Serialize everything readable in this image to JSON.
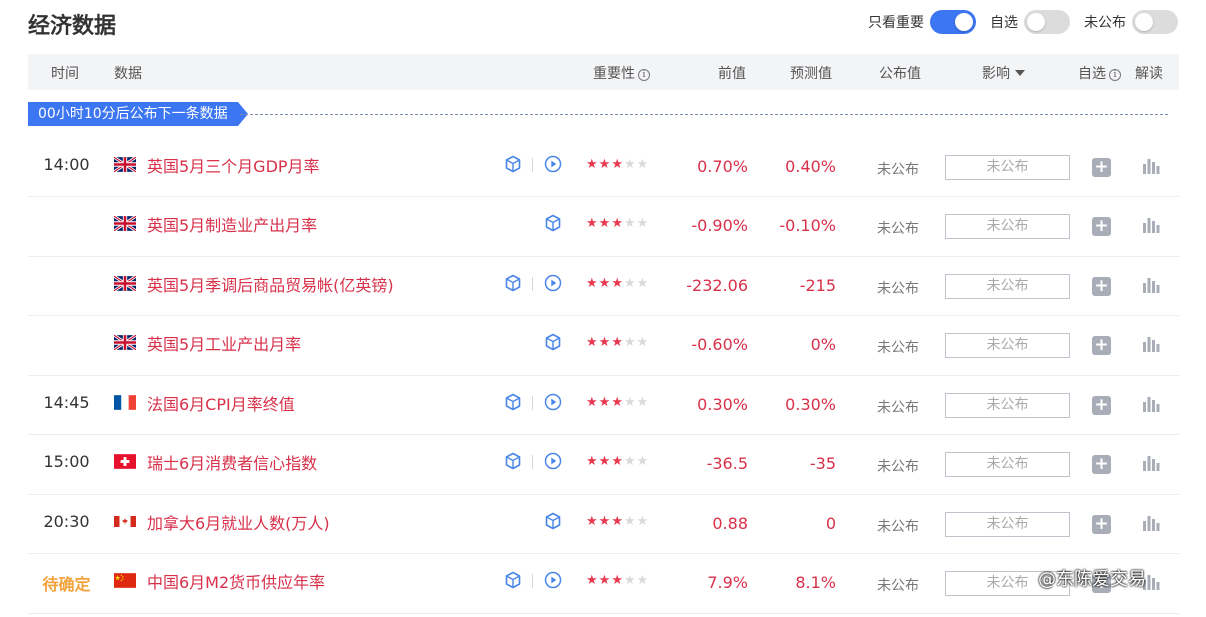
{
  "page_title": "经济数据",
  "toggles": [
    {
      "label": "只看重要",
      "state": "on"
    },
    {
      "label": "自选",
      "state": "off"
    },
    {
      "label": "未公布",
      "state": "off"
    }
  ],
  "columns": {
    "time": "时间",
    "data": "数据",
    "importance": "重要性",
    "previous": "前值",
    "forecast": "预测值",
    "actual": "公布值",
    "impact": "影响",
    "watchlist": "自选",
    "analysis": "解读"
  },
  "info_glyph": "i",
  "next_release_banner": "00小时10分后公布下一条数据",
  "rows": [
    {
      "time": "14:00",
      "flag": "uk",
      "name": "英国5月三个月GDP月率",
      "has_cube": true,
      "has_play": true,
      "stars": 3,
      "previous": "0.70%",
      "forecast": "0.40%",
      "actual": "未公布",
      "impact": "未公布"
    },
    {
      "time": "",
      "flag": "uk",
      "name": "英国5月制造业产出月率",
      "has_cube": true,
      "has_play": false,
      "stars": 3,
      "previous": "-0.90%",
      "forecast": "-0.10%",
      "actual": "未公布",
      "impact": "未公布"
    },
    {
      "time": "",
      "flag": "uk",
      "name": "英国5月季调后商品贸易帐(亿英镑)",
      "has_cube": true,
      "has_play": true,
      "stars": 3,
      "previous": "-232.06",
      "forecast": "-215",
      "actual": "未公布",
      "impact": "未公布"
    },
    {
      "time": "",
      "flag": "uk",
      "name": "英国5月工业产出月率",
      "has_cube": true,
      "has_play": false,
      "stars": 3,
      "previous": "-0.60%",
      "forecast": "0%",
      "actual": "未公布",
      "impact": "未公布"
    },
    {
      "time": "14:45",
      "flag": "fr",
      "name": "法国6月CPI月率终值",
      "has_cube": true,
      "has_play": true,
      "stars": 3,
      "previous": "0.30%",
      "forecast": "0.30%",
      "actual": "未公布",
      "impact": "未公布"
    },
    {
      "time": "15:00",
      "flag": "ch",
      "name": "瑞士6月消费者信心指数",
      "has_cube": true,
      "has_play": true,
      "stars": 3,
      "previous": "-36.5",
      "forecast": "-35",
      "actual": "未公布",
      "impact": "未公布"
    },
    {
      "time": "20:30",
      "flag": "ca",
      "name": "加拿大6月就业人数(万人)",
      "has_cube": true,
      "has_play": false,
      "stars": 3,
      "previous": "0.88",
      "forecast": "0",
      "actual": "未公布",
      "impact": "未公布"
    },
    {
      "time": "待确定",
      "time_pending": true,
      "flag": "cn",
      "name": "中国6月M2货币供应年率",
      "has_cube": true,
      "has_play": true,
      "stars": 3,
      "previous": "7.9%",
      "forecast": "8.1%",
      "actual": "未公布",
      "impact": "未公布"
    }
  ],
  "max_stars": 5,
  "colors": {
    "accent": "#3d76f2",
    "value_red": "#d9304a",
    "pending_orange": "#f3a23c",
    "star_red": "#e8384f"
  },
  "watermark": "@东陈爱交易"
}
